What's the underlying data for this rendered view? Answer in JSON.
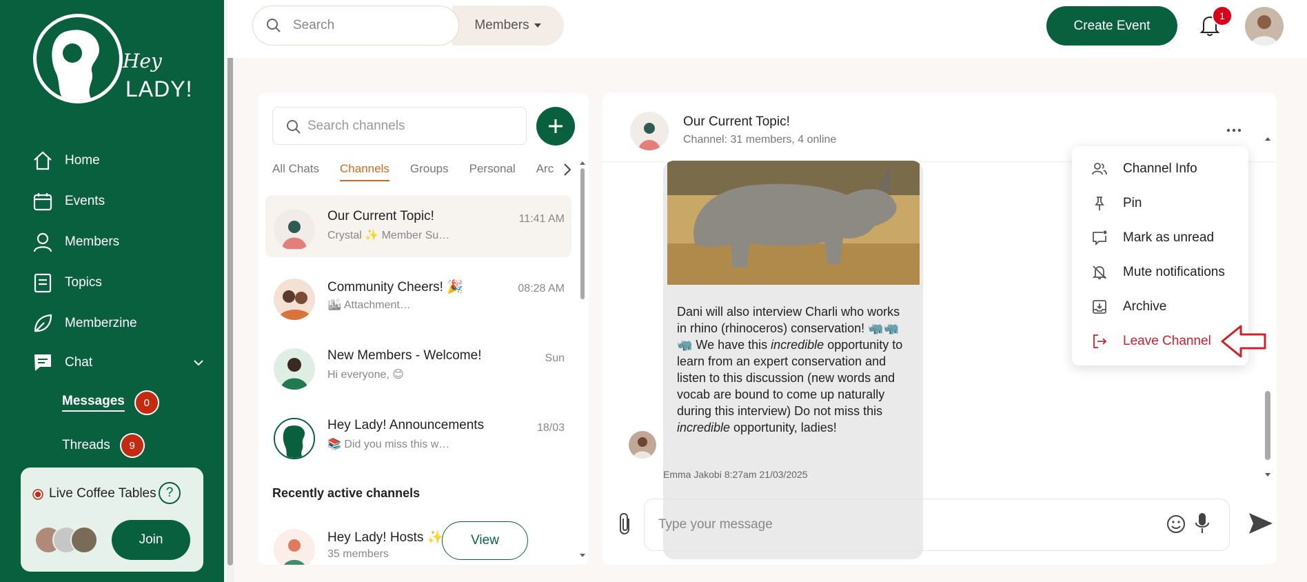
{
  "brand": {
    "logo_line1": "Hey",
    "logo_line2": "LADY!"
  },
  "sidebar": {
    "nav": [
      {
        "label": "Home",
        "icon": "home-icon"
      },
      {
        "label": "Events",
        "icon": "calendar-icon"
      },
      {
        "label": "Members",
        "icon": "person-icon"
      },
      {
        "label": "Topics",
        "icon": "document-icon"
      },
      {
        "label": "Memberzine",
        "icon": "leaf-icon"
      },
      {
        "label": "Chat",
        "icon": "chat-icon"
      }
    ],
    "messages_label": "Messages",
    "messages_count": "0",
    "threads_label": "Threads",
    "threads_count": "9",
    "coffee": {
      "label": "Live Coffee Tables",
      "help": "?",
      "join": "Join"
    }
  },
  "topbar": {
    "search_placeholder": "Search",
    "members_label": "Members",
    "create_event": "Create Event",
    "notification_count": "1"
  },
  "channels": {
    "search_placeholder": "Search channels",
    "tabs": [
      "All Chats",
      "Channels",
      "Groups",
      "Personal",
      "Arc"
    ],
    "active_tab": "Channels",
    "items": [
      {
        "name": "Our Current Topic!",
        "preview": "Crystal ✨ Member Su…",
        "time": "11:41 AM"
      },
      {
        "name": "Community Cheers! 🎉",
        "preview": "🏙 Attachment…",
        "time": "08:28 AM"
      },
      {
        "name": "New Members - Welcome!",
        "preview": "Hi everyone, 😊",
        "time": "Sun"
      },
      {
        "name": "Hey Lady! Announcements",
        "preview": "📚 Did you miss this w…",
        "time": "18/03"
      }
    ],
    "recent_heading": "Recently active channels",
    "recent": {
      "name": "Hey Lady! Hosts ✨",
      "sub": "35 members",
      "action": "View"
    }
  },
  "chat": {
    "title": "Our Current Topic!",
    "subtitle": "Channel: 31 members, 4 online",
    "message": {
      "part1": "Dani will also interview Charli who works in rhino (rhinoceros) conserva­tion! 🦏🦏🦏 We have this ",
      "em1": "incredible",
      "part2": " opportunity to learn from an expert conservation and listen to this discus­sion (new words and vocab are bound to come up naturally during this inter­view) Do not miss this ",
      "em2": "incredible",
      "part3": " oppor­tunity, ladies!"
    },
    "meta_author": "Emma Jakobi",
    "meta_time": "8:27am",
    "meta_date": "21/03/2025",
    "input_placeholder": "Type your message"
  },
  "menu": {
    "items": [
      {
        "label": "Channel Info",
        "icon": "people-icon"
      },
      {
        "label": "Pin",
        "icon": "pin-icon"
      },
      {
        "label": "Mark as unread",
        "icon": "message-dot-icon"
      },
      {
        "label": "Mute notifications",
        "icon": "bell-off-icon"
      },
      {
        "label": "Archive",
        "icon": "archive-icon"
      },
      {
        "label": "Leave Channel",
        "icon": "logout-icon"
      }
    ],
    "danger_color": "#d0202a"
  },
  "colors": {
    "brand_green": "#08603f",
    "accent_orange": "#d2691e",
    "badge_red": "#c42a12"
  }
}
